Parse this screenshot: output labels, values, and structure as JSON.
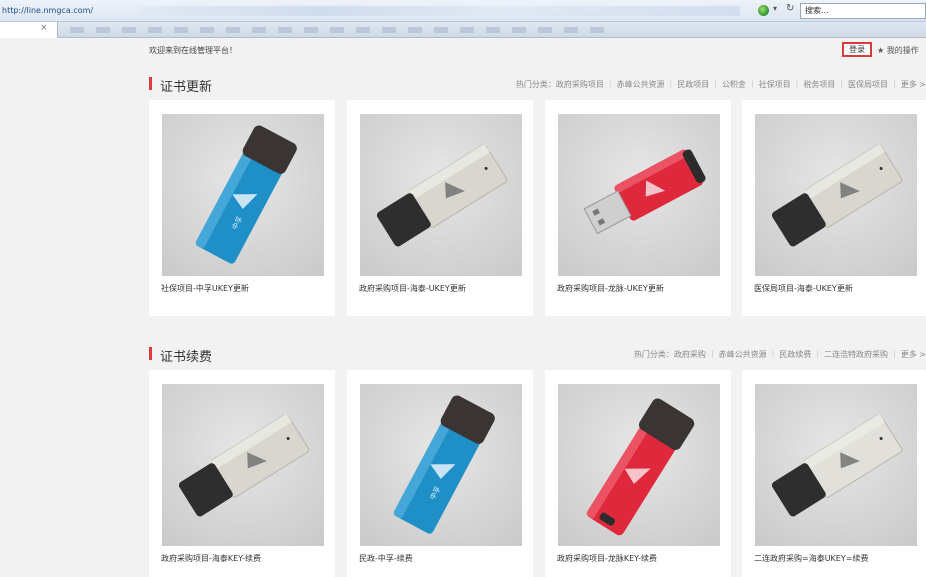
{
  "browser": {
    "url": "http://line.nmgca.com/",
    "search_placeholder": "搜索..."
  },
  "header": {
    "welcome": "欢迎来到在线管理平台！",
    "login_label": "登录",
    "my_ops_label": "★ 我的操作"
  },
  "sections": [
    {
      "title": "证书更新",
      "hot_label": "热门分类：",
      "categories": [
        "政府采购项目",
        "赤峰公共资源",
        "民政项目",
        "公积金",
        "社保项目",
        "税务项目",
        "医保局项目",
        "更多 >"
      ],
      "cards": [
        {
          "label": "社保项目-中孚UKEY更新",
          "device": "blue"
        },
        {
          "label": "政府采购项目-海泰-UKEY更新",
          "device": "silver"
        },
        {
          "label": "政府采购项目-龙脉-UKEY更新",
          "device": "red-open"
        },
        {
          "label": "医保局项目-海泰-UKEY更新",
          "device": "silver"
        }
      ]
    },
    {
      "title": "证书续费",
      "hot_label": "热门分类：",
      "categories": [
        "政府采购",
        "赤峰公共资源",
        "民政续费",
        "二连浩特政府采购",
        "更多 >"
      ],
      "cards": [
        {
          "label": "政府采购项目-海泰KEY-续费",
          "device": "silver"
        },
        {
          "label": "民政-中孚-续费",
          "device": "blue"
        },
        {
          "label": "政府采购项目-龙脉KEY-续费",
          "device": "red"
        },
        {
          "label": "二连政府采购=海泰UKEY=续费",
          "device": "silver-light"
        }
      ]
    }
  ],
  "colors": {
    "accent": "#e03b3b",
    "blue_key": "#1f8fc8",
    "red_key": "#e0283c",
    "silver_key": "#d8d6cf"
  }
}
